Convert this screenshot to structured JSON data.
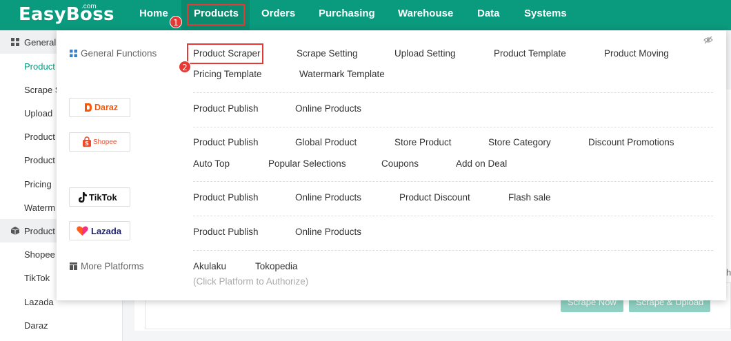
{
  "header": {
    "logo": "EasyBoss",
    "logo_sup": ".com",
    "nav": [
      "Home",
      "Products",
      "Orders",
      "Purchasing",
      "Warehouse",
      "Data",
      "Systems"
    ],
    "active_nav": "Products"
  },
  "steps": [
    "1",
    "2"
  ],
  "sidebar": {
    "group1": "General",
    "items1": [
      "Product",
      "Scrape S",
      "Upload",
      "Product",
      "Product",
      "Pricing",
      "Waterm"
    ],
    "group2": "Product",
    "items2": [
      "Shopee",
      "TikTok",
      "Lazada",
      "Daraz"
    ]
  },
  "background": {
    "buttons": [
      "Scrape Now",
      "Scrape & Upload"
    ],
    "edge_char": "h"
  },
  "dropdown": {
    "general_label": "General Functions",
    "general_row1": [
      "Product Scraper",
      "Scrape Setting",
      "Upload Setting",
      "Product Template",
      "Product Moving"
    ],
    "general_row2": [
      "Pricing Template",
      "Watermark Template"
    ],
    "daraz": {
      "name": "Daraz",
      "links": [
        "Product Publish",
        "Online Products"
      ]
    },
    "shopee": {
      "name": "Shopee",
      "links_row1": [
        "Product Publish",
        "Global Product",
        "Store Product",
        "Store Category",
        "Discount Promotions"
      ],
      "links_row2": [
        "Auto Top",
        "Popular Selections",
        "Coupons",
        "Add on Deal"
      ]
    },
    "tiktok": {
      "name": "TikTok",
      "links": [
        "Product Publish",
        "Online Products",
        "Product Discount",
        "Flash sale"
      ]
    },
    "lazada": {
      "name": "Lazada",
      "links": [
        "Product Publish",
        "Online Products"
      ]
    },
    "more_label": "More Platforms",
    "more_links": [
      "Akulaku",
      "Tokopedia"
    ],
    "more_hint": "(Click Platform to Authorize)"
  },
  "colors": {
    "brand": "#0a9a7d",
    "highlight": "#e53935",
    "daraz": "#f85606",
    "shopee": "#ee4d2d",
    "lazada": "#1a1e6e"
  }
}
